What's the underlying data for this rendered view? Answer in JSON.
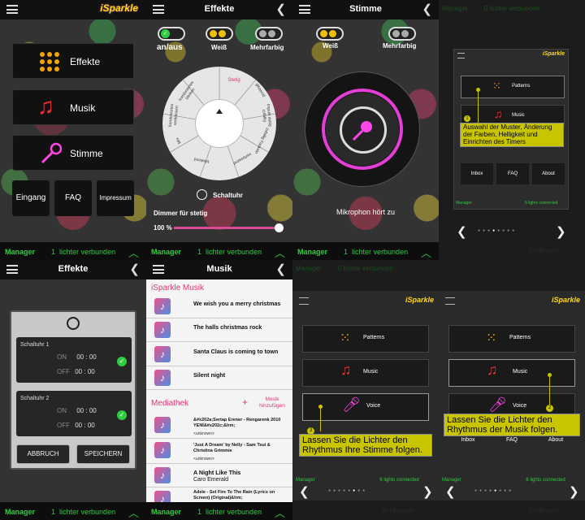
{
  "app": {
    "logo": "iSparkle"
  },
  "bottom": {
    "manager": "Manager",
    "count": "1",
    "connected": "lichter verbunden",
    "small_connected": "6 lights connected",
    "faded_connected": "0 lichter verbunden",
    "close": "Schliessen"
  },
  "main_menu": {
    "effects": "Effekte",
    "music": "Musik",
    "voice": "Stimme",
    "input": "Eingang",
    "faq": "FAQ",
    "impressum": "Impressum"
  },
  "effects": {
    "title": "Effekte",
    "onoff": "an/aus",
    "white": "Weiß",
    "multicolor": "Mehrfarbig",
    "wheel_segments": [
      "Stetig",
      "glitzernd",
      "Impuls stetig zufällig",
      "zufallig Funkeln",
      "verfassend",
      "blinkend",
      "Mix",
      "kombiniertes verblassen",
      "kombiniertes blinken"
    ],
    "timer_label": "Schaltuhr",
    "dimmer_label": "Dimmer für stetig",
    "dimmer_value": "100",
    "dimmer_unit": "%",
    "dimmer_level": 1.0
  },
  "voice": {
    "title": "Stimme",
    "white": "Weiß",
    "multicolor": "Mehrfarbig",
    "status": "Mikrophon hört zu"
  },
  "tutorial1": {
    "patterns": "Patterns",
    "music": "Music",
    "inbox": "Inbox",
    "faq": "FAQ",
    "about": "About",
    "step": "1",
    "callout": "Auswahl der Muster, Änderung der Farben, Helligkeit und Einrichten des Timers"
  },
  "timer": {
    "title": "Effekte",
    "group1": "Schaltuhr 1",
    "group2": "Schaltuhr 2",
    "on": "ON",
    "off": "OFF",
    "hh": "00",
    "mm": "00",
    "cancel": "ABBRUCH",
    "save": "SPEICHERN"
  },
  "music": {
    "title": "Musik",
    "section1": "iSparkle Musik",
    "songs": [
      "We wish you a merry christmas",
      "The halls christmas rock",
      "Santa Claus is coming to town",
      "Silent night"
    ],
    "section2": "Mediathek",
    "add_label": "Musik hinzufügen",
    "library": [
      {
        "t": "&#x202a;Sertap Erener - Rengarenk 2010 YENİ&#x202c;&lrm;",
        "sub": "<unknown>"
      },
      {
        "t": "'Just A Dream' by Nelly - Sam Tsui & Christina Grimmie",
        "sub": "<unknown>"
      },
      {
        "t": "A Night Like This",
        "sub": "Caro Emerald"
      },
      {
        "t": "Adele - Set Fire To The Rain (Lyrics on Screen) (Original)&lrm;",
        "sub": "<unknown>"
      }
    ]
  },
  "tutorial3": {
    "patterns": "Patterns",
    "music": "Music",
    "voice": "Voice",
    "step": "3",
    "callout": "Lassen Sie die Lichter den Rhythmus Ihre Stimme folgen."
  },
  "tutorial2": {
    "patterns": "Patterns",
    "music": "Music",
    "voice": "Voice",
    "inbox": "Inbox",
    "faq": "FAQ",
    "about": "About",
    "step": "2",
    "callout": "Lassen Sie die Lichter den Rhythmus der Musik folgen."
  },
  "colors": {
    "accent_green": "#2ecc40",
    "magenta": "#e33fd7",
    "callout_yellow": "#c9c400",
    "pink_header": "#e8356e"
  }
}
